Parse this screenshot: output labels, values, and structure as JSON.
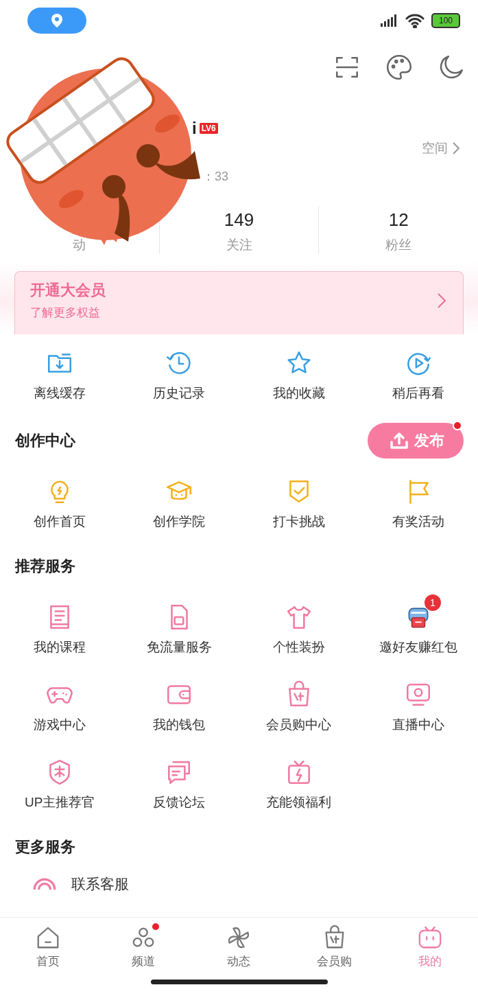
{
  "status_bar": {
    "battery": "100"
  },
  "profile": {
    "name": "i",
    "level": "LV6",
    "space_link": "空间",
    "coins": "：33"
  },
  "stats": [
    {
      "label": "动"
    },
    {
      "count": "149",
      "label": "关注"
    },
    {
      "count": "12",
      "label": "粉丝"
    }
  ],
  "vip_banner": {
    "title": "开通大会员",
    "subtitle": "了解更多权益"
  },
  "quick_actions": [
    {
      "label": "离线缓存"
    },
    {
      "label": "历史记录"
    },
    {
      "label": "我的收藏"
    },
    {
      "label": "稍后再看"
    }
  ],
  "creation": {
    "title": "创作中心",
    "publish": {
      "label": "发布",
      "dot": true
    },
    "items": [
      {
        "label": "创作首页"
      },
      {
        "label": "创作学院"
      },
      {
        "label": "打卡挑战"
      },
      {
        "label": "有奖活动"
      }
    ]
  },
  "services": {
    "title": "推荐服务",
    "items": [
      {
        "label": "我的课程"
      },
      {
        "label": "免流量服务"
      },
      {
        "label": "个性装扮"
      },
      {
        "label": "邀好友赚红包",
        "badge": "1"
      },
      {
        "label": "游戏中心"
      },
      {
        "label": "我的钱包"
      },
      {
        "label": "会员购中心"
      },
      {
        "label": "直播中心"
      },
      {
        "label": "UP主推荐官"
      },
      {
        "label": "反馈论坛"
      },
      {
        "label": "充能领福利"
      }
    ]
  },
  "more_services": {
    "title": "更多服务",
    "items": [
      {
        "label": "联系客服"
      }
    ]
  },
  "tabs": [
    {
      "label": "首页",
      "selected": false,
      "dot": false
    },
    {
      "label": "频道",
      "selected": false,
      "dot": true
    },
    {
      "label": "动态",
      "selected": false,
      "dot": false
    },
    {
      "label": "会员购",
      "selected": false,
      "dot": false
    },
    {
      "label": "我的",
      "selected": true,
      "dot": false
    }
  ]
}
